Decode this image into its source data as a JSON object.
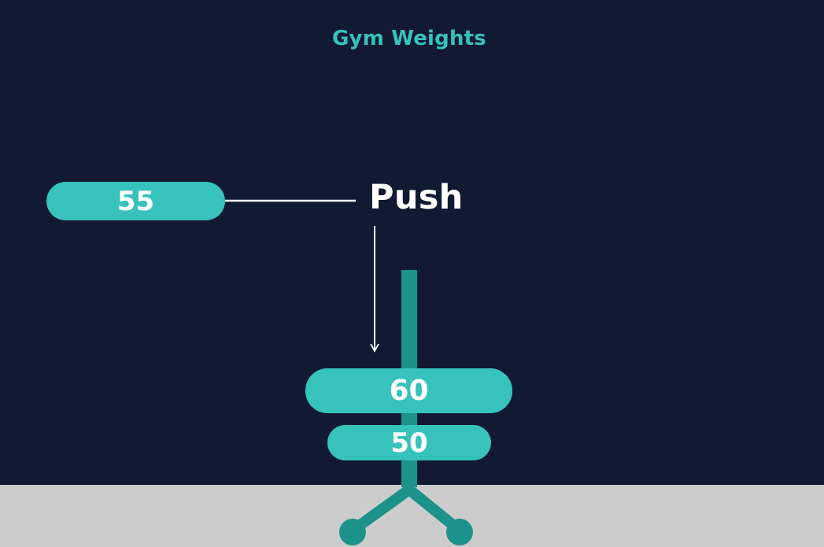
{
  "title": "Gym Weights",
  "action_label": "Push",
  "incoming_plate": {
    "value": "55"
  },
  "stack": {
    "plates": [
      {
        "value": "60"
      },
      {
        "value": "50"
      }
    ]
  },
  "colors": {
    "background": "#111a32",
    "floor": "#cccccc",
    "plate": "#37c2bc",
    "rack": "#1c928a",
    "title": "#37c2bc",
    "connector": "#ffffff",
    "label": "#ffffff"
  }
}
